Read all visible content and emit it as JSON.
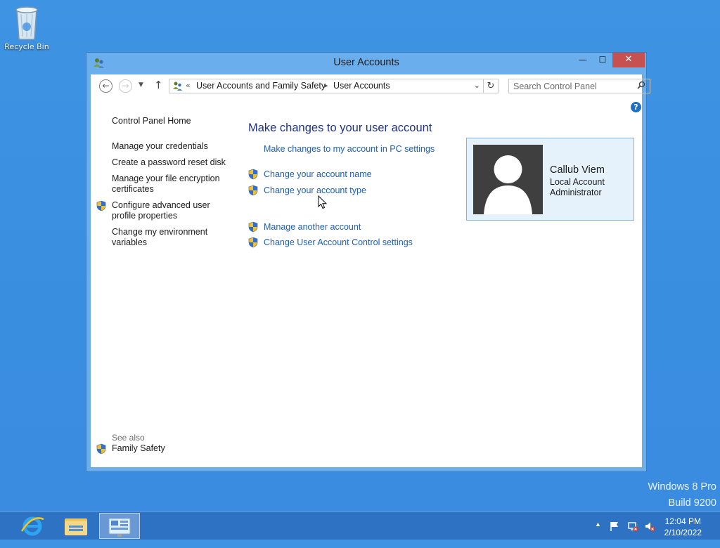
{
  "desktop": {
    "recycle_bin_label": "Recycle Bin"
  },
  "window": {
    "title": "User Accounts",
    "controls": {
      "minimize": "—",
      "maximize": "☐",
      "close": "✕"
    }
  },
  "navbar": {
    "breadcrumb_prefix": "«",
    "breadcrumbs": [
      "User Accounts and Family Safety",
      "User Accounts"
    ],
    "search_placeholder": "Search Control Panel"
  },
  "left_pane": {
    "home": "Control Panel Home",
    "links": [
      "Manage your credentials",
      "Create a password reset disk",
      "Manage your file encryption certificates",
      "Configure advanced user profile properties",
      "Change my environment variables"
    ],
    "see_also_label": "See also",
    "see_also_links": [
      "Family Safety"
    ]
  },
  "main": {
    "heading": "Make changes to your user account",
    "links": [
      "Make changes to my account in PC settings",
      "Change your account name",
      "Change your account type",
      "Manage another account",
      "Change User Account Control settings"
    ]
  },
  "account": {
    "name": "Callub Viem",
    "type": "Local Account",
    "role": "Administrator"
  },
  "watermark": {
    "line1": "Windows 8 Pro",
    "line2": "Build 9200"
  },
  "taskbar": {
    "apps": [
      "internet-explorer-icon",
      "file-explorer-icon",
      "control-panel-icon"
    ],
    "tray": {
      "expand": "▲",
      "time": "12:04 PM",
      "date": "2/10/2022"
    }
  },
  "colors": {
    "desktop": "#3a8ee0",
    "window_frame": "#6aaeed",
    "close_button": "#c75050",
    "link": "#1e5fb4",
    "heading": "#1e3287",
    "account_card": "#e6f2fb",
    "taskbar": "#2e72c4"
  }
}
